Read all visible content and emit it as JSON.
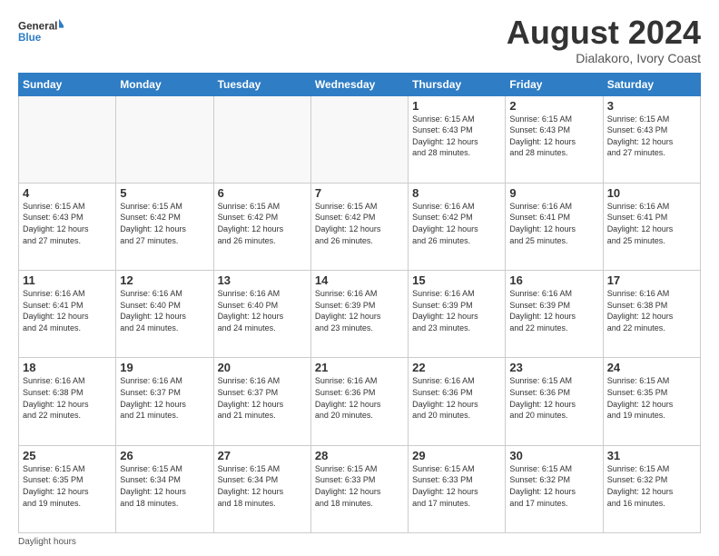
{
  "logo": {
    "line1": "General",
    "line2": "Blue"
  },
  "title": "August 2024",
  "subtitle": "Dialakoro, Ivory Coast",
  "days_header": [
    "Sunday",
    "Monday",
    "Tuesday",
    "Wednesday",
    "Thursday",
    "Friday",
    "Saturday"
  ],
  "footer_label": "Daylight hours",
  "weeks": [
    [
      {
        "num": "",
        "info": ""
      },
      {
        "num": "",
        "info": ""
      },
      {
        "num": "",
        "info": ""
      },
      {
        "num": "",
        "info": ""
      },
      {
        "num": "1",
        "info": "Sunrise: 6:15 AM\nSunset: 6:43 PM\nDaylight: 12 hours\nand 28 minutes."
      },
      {
        "num": "2",
        "info": "Sunrise: 6:15 AM\nSunset: 6:43 PM\nDaylight: 12 hours\nand 28 minutes."
      },
      {
        "num": "3",
        "info": "Sunrise: 6:15 AM\nSunset: 6:43 PM\nDaylight: 12 hours\nand 27 minutes."
      }
    ],
    [
      {
        "num": "4",
        "info": "Sunrise: 6:15 AM\nSunset: 6:43 PM\nDaylight: 12 hours\nand 27 minutes."
      },
      {
        "num": "5",
        "info": "Sunrise: 6:15 AM\nSunset: 6:42 PM\nDaylight: 12 hours\nand 27 minutes."
      },
      {
        "num": "6",
        "info": "Sunrise: 6:15 AM\nSunset: 6:42 PM\nDaylight: 12 hours\nand 26 minutes."
      },
      {
        "num": "7",
        "info": "Sunrise: 6:15 AM\nSunset: 6:42 PM\nDaylight: 12 hours\nand 26 minutes."
      },
      {
        "num": "8",
        "info": "Sunrise: 6:16 AM\nSunset: 6:42 PM\nDaylight: 12 hours\nand 26 minutes."
      },
      {
        "num": "9",
        "info": "Sunrise: 6:16 AM\nSunset: 6:41 PM\nDaylight: 12 hours\nand 25 minutes."
      },
      {
        "num": "10",
        "info": "Sunrise: 6:16 AM\nSunset: 6:41 PM\nDaylight: 12 hours\nand 25 minutes."
      }
    ],
    [
      {
        "num": "11",
        "info": "Sunrise: 6:16 AM\nSunset: 6:41 PM\nDaylight: 12 hours\nand 24 minutes."
      },
      {
        "num": "12",
        "info": "Sunrise: 6:16 AM\nSunset: 6:40 PM\nDaylight: 12 hours\nand 24 minutes."
      },
      {
        "num": "13",
        "info": "Sunrise: 6:16 AM\nSunset: 6:40 PM\nDaylight: 12 hours\nand 24 minutes."
      },
      {
        "num": "14",
        "info": "Sunrise: 6:16 AM\nSunset: 6:39 PM\nDaylight: 12 hours\nand 23 minutes."
      },
      {
        "num": "15",
        "info": "Sunrise: 6:16 AM\nSunset: 6:39 PM\nDaylight: 12 hours\nand 23 minutes."
      },
      {
        "num": "16",
        "info": "Sunrise: 6:16 AM\nSunset: 6:39 PM\nDaylight: 12 hours\nand 22 minutes."
      },
      {
        "num": "17",
        "info": "Sunrise: 6:16 AM\nSunset: 6:38 PM\nDaylight: 12 hours\nand 22 minutes."
      }
    ],
    [
      {
        "num": "18",
        "info": "Sunrise: 6:16 AM\nSunset: 6:38 PM\nDaylight: 12 hours\nand 22 minutes."
      },
      {
        "num": "19",
        "info": "Sunrise: 6:16 AM\nSunset: 6:37 PM\nDaylight: 12 hours\nand 21 minutes."
      },
      {
        "num": "20",
        "info": "Sunrise: 6:16 AM\nSunset: 6:37 PM\nDaylight: 12 hours\nand 21 minutes."
      },
      {
        "num": "21",
        "info": "Sunrise: 6:16 AM\nSunset: 6:36 PM\nDaylight: 12 hours\nand 20 minutes."
      },
      {
        "num": "22",
        "info": "Sunrise: 6:16 AM\nSunset: 6:36 PM\nDaylight: 12 hours\nand 20 minutes."
      },
      {
        "num": "23",
        "info": "Sunrise: 6:15 AM\nSunset: 6:36 PM\nDaylight: 12 hours\nand 20 minutes."
      },
      {
        "num": "24",
        "info": "Sunrise: 6:15 AM\nSunset: 6:35 PM\nDaylight: 12 hours\nand 19 minutes."
      }
    ],
    [
      {
        "num": "25",
        "info": "Sunrise: 6:15 AM\nSunset: 6:35 PM\nDaylight: 12 hours\nand 19 minutes."
      },
      {
        "num": "26",
        "info": "Sunrise: 6:15 AM\nSunset: 6:34 PM\nDaylight: 12 hours\nand 18 minutes."
      },
      {
        "num": "27",
        "info": "Sunrise: 6:15 AM\nSunset: 6:34 PM\nDaylight: 12 hours\nand 18 minutes."
      },
      {
        "num": "28",
        "info": "Sunrise: 6:15 AM\nSunset: 6:33 PM\nDaylight: 12 hours\nand 18 minutes."
      },
      {
        "num": "29",
        "info": "Sunrise: 6:15 AM\nSunset: 6:33 PM\nDaylight: 12 hours\nand 17 minutes."
      },
      {
        "num": "30",
        "info": "Sunrise: 6:15 AM\nSunset: 6:32 PM\nDaylight: 12 hours\nand 17 minutes."
      },
      {
        "num": "31",
        "info": "Sunrise: 6:15 AM\nSunset: 6:32 PM\nDaylight: 12 hours\nand 16 minutes."
      }
    ]
  ]
}
